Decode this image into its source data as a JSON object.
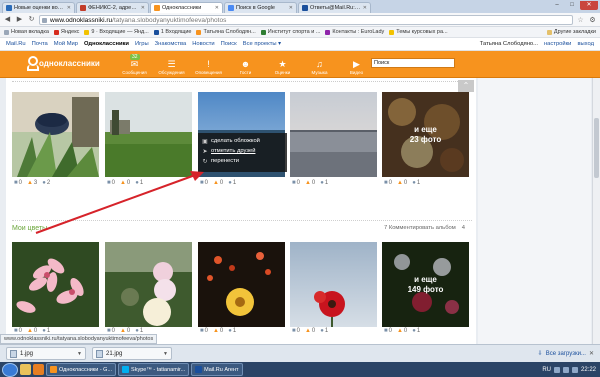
{
  "browser": {
    "tabs": [
      {
        "label": "Новые оценки вопросов",
        "color": "#2a6bb8",
        "active": false
      },
      {
        "label": "ФЕНИКС-2, адрес, телеф",
        "color": "#c23c2a",
        "active": false
      },
      {
        "label": "Одноклассники",
        "color": "#f7931e",
        "active": true
      },
      {
        "label": "Поиск в Google",
        "color": "#4a8af4",
        "active": false
      },
      {
        "label": "Ответы@Mail.Ru: Челов",
        "color": "#1a4f9c",
        "active": false
      }
    ],
    "url_host": "www.odnoklassniki.ru",
    "url_path": "/tatyana.slobodyanyuktimofeeva/photos",
    "bookmarks": [
      {
        "label": "Новая вкладка",
        "color": "#9aa7b8"
      },
      {
        "label": "Яндекс",
        "color": "#d62b1e"
      },
      {
        "label": "9 · Входящие — Янд...",
        "color": "#f2c200"
      },
      {
        "label": "1 Входящие",
        "color": "#1a4f9c"
      },
      {
        "label": "Татьяна Слободян...",
        "color": "#f7931e"
      },
      {
        "label": "Институт спорта и ...",
        "color": "#2e7d32"
      },
      {
        "label": "Контакты : EuroLady",
        "color": "#8e24aa"
      },
      {
        "label": "Темы курсовых ра...",
        "color": "#f2c200"
      }
    ],
    "bookmarks_other": "Другие закладки"
  },
  "portal": {
    "links": [
      "Mail.Ru",
      "Почта",
      "Мой Мир",
      "Одноклассники",
      "Игры",
      "Знакомства",
      "Новости",
      "Поиск",
      "Все проекты ▾"
    ],
    "current": "Одноклассники",
    "user": "Татьяна Слободяно...",
    "settings": "настройки",
    "logout": "выход"
  },
  "ok": {
    "logo": "одноклассники",
    "badge": "32",
    "nav": [
      {
        "label": "Сообщения",
        "icon": "envelope-icon",
        "glyph": "✉"
      },
      {
        "label": "Обсуждения",
        "icon": "chat-icon",
        "glyph": "☰"
      },
      {
        "label": "Оповещения",
        "icon": "bell-icon",
        "glyph": "!"
      },
      {
        "label": "Гости",
        "icon": "guests-icon",
        "glyph": "☻"
      },
      {
        "label": "Оценки",
        "icon": "rating-icon",
        "glyph": "★"
      },
      {
        "label": "Музыка",
        "icon": "music-icon",
        "glyph": "♫"
      },
      {
        "label": "Видео",
        "icon": "video-icon",
        "glyph": "▶"
      }
    ],
    "search_placeholder": "Поиск"
  },
  "album1": {
    "photos": [
      {
        "more_label": "",
        "more_count": "",
        "comments": "0",
        "likes": "3",
        "shares": "2"
      },
      {
        "more_label": "",
        "more_count": "",
        "comments": "0",
        "likes": "0",
        "shares": "1"
      },
      {
        "more_label": "",
        "more_count": "",
        "comments": "0",
        "likes": "0",
        "shares": "1"
      },
      {
        "more_label": "",
        "more_count": "",
        "comments": "0",
        "likes": "0",
        "shares": "1"
      },
      {
        "more_label": "и еще",
        "more_count": "23 фото",
        "comments": "0",
        "likes": "0",
        "shares": "1"
      }
    ],
    "menu": [
      "сделать обложкой",
      "отметить друзей",
      "перенести"
    ]
  },
  "album2": {
    "title": "Мои цветы",
    "comment_link": "7 Комментировать альбом",
    "like_count": "4",
    "photos": [
      {
        "more_label": "",
        "more_count": "",
        "comments": "0",
        "likes": "0",
        "shares": "1"
      },
      {
        "more_label": "",
        "more_count": "",
        "comments": "0",
        "likes": "0",
        "shares": "1"
      },
      {
        "more_label": "",
        "more_count": "",
        "comments": "0",
        "likes": "0",
        "shares": "1"
      },
      {
        "more_label": "",
        "more_count": "",
        "comments": "0",
        "likes": "0",
        "shares": "1"
      },
      {
        "more_label": "и еще",
        "more_count": "149 фото",
        "comments": "0",
        "likes": "0",
        "shares": "1"
      }
    ]
  },
  "status_url": "www.odnoklassniki.ru/tatyana.slobodyanyuktimofeeva/photos",
  "downloads": {
    "files": [
      "1.jpg",
      "21.jpg"
    ],
    "all": "Все загрузки..."
  },
  "taskbar": {
    "items": [
      {
        "label": "Одноклассники - G...",
        "color": "#f7931e"
      },
      {
        "label": "Skype™ - tatianamir...",
        "color": "#00aff0"
      },
      {
        "label": "Mail.Ru Агент",
        "color": "#1a4f9c"
      }
    ],
    "lang": "RU",
    "time": "22:22"
  }
}
